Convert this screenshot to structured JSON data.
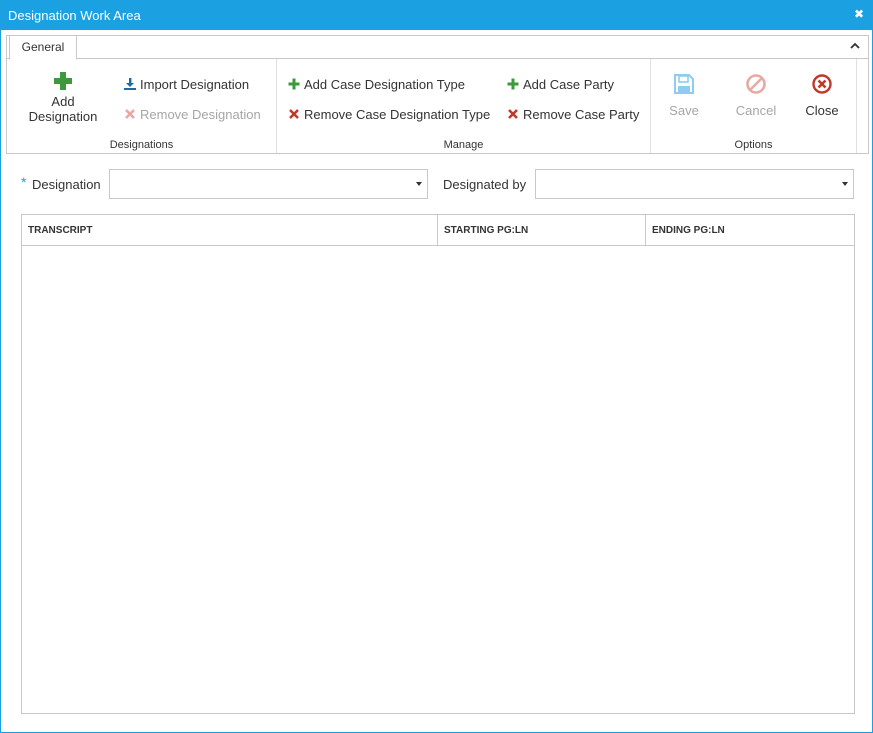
{
  "window": {
    "title": "Designation Work Area"
  },
  "ribbon": {
    "tab": "General",
    "groups": {
      "designations": {
        "label": "Designations",
        "add_label_line1": "Add",
        "add_label_line2": "Designation",
        "import_label": "Import Designation",
        "remove_label": "Remove Designation"
      },
      "manage": {
        "label": "Manage",
        "add_case_designation_type": "Add Case Designation Type",
        "remove_case_designation_type": "Remove Case Designation Type",
        "add_case_party": "Add Case Party",
        "remove_case_party": "Remove Case Party"
      },
      "options": {
        "label": "Options",
        "save": "Save",
        "cancel": "Cancel",
        "close": "Close"
      }
    }
  },
  "form": {
    "required_marker": "*",
    "designation_label": "Designation",
    "designation_value": "",
    "designated_by_label": "Designated by",
    "designated_by_value": ""
  },
  "grid": {
    "columns": [
      "TRANSCRIPT",
      "STARTING PG:LN",
      "ENDING PG:LN"
    ],
    "rows": []
  },
  "colors": {
    "accent": "#1ba1e2",
    "add_green": "#3c9a3c",
    "remove_red": "#c0392b",
    "disabled": "#a6a6a6"
  },
  "icons": {
    "title_close": "close-icon",
    "collapse": "chevron-up-icon",
    "add": "plus-icon",
    "import": "download-icon",
    "remove": "x-icon",
    "save": "floppy-disk-icon",
    "cancel": "cancel-circle-icon",
    "close": "close-circle-icon"
  }
}
